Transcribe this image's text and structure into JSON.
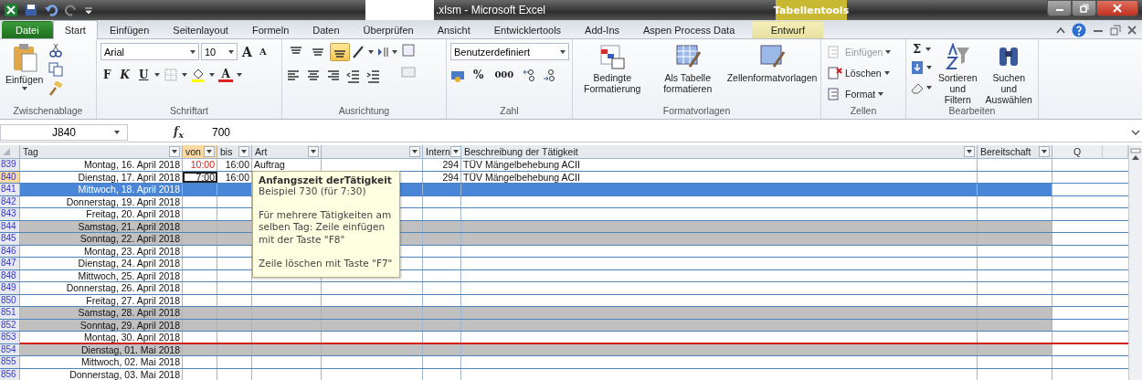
{
  "window": {
    "title": ".xlsm  -  Microsoft Excel",
    "context_tab_group": "Tabellentools"
  },
  "tabs": [
    {
      "label": "Datei",
      "kind": "file",
      "selected": false
    },
    {
      "label": "Start",
      "kind": "normal",
      "selected": true
    },
    {
      "label": "Einfügen",
      "kind": "normal",
      "selected": false
    },
    {
      "label": "Seitenlayout",
      "kind": "normal",
      "selected": false
    },
    {
      "label": "Formeln",
      "kind": "normal",
      "selected": false
    },
    {
      "label": "Daten",
      "kind": "normal",
      "selected": false
    },
    {
      "label": "Überprüfen",
      "kind": "normal",
      "selected": false
    },
    {
      "label": "Ansicht",
      "kind": "normal",
      "selected": false
    },
    {
      "label": "Entwicklertools",
      "kind": "normal",
      "selected": false
    },
    {
      "label": "Add-Ins",
      "kind": "normal",
      "selected": false
    },
    {
      "label": "Aspen Process Data",
      "kind": "normal",
      "selected": false
    },
    {
      "label": "Entwurf",
      "kind": "contextual",
      "selected": false
    }
  ],
  "ribbon": {
    "clipboard": {
      "label": "Zwischenablage",
      "paste": "Einfügen"
    },
    "font": {
      "label": "Schriftart",
      "font_name": "Arial",
      "font_size": "10",
      "grow": "A",
      "shrink": "A",
      "bold": "F",
      "italic": "K",
      "underline": "U",
      "font_color": "A"
    },
    "alignment": {
      "label": "Ausrichtung",
      "vertical": [
        {
          "selected": false
        },
        {
          "selected": false
        },
        {
          "selected": true
        }
      ]
    },
    "number": {
      "label": "Zahl",
      "format": "Benutzerdefiniert",
      "percent": "%",
      "thousands": "000"
    },
    "styles": {
      "label": "Formatvorlagen",
      "buttons": [
        {
          "label": "Bedingte Formatierung",
          "kind": "conditional"
        },
        {
          "label": "Als Tabelle formatieren",
          "kind": "table"
        },
        {
          "label": "Zellenformatvorlagen",
          "kind": "cellstyle"
        }
      ]
    },
    "cells": {
      "label": "Zellen",
      "buttons": [
        {
          "label": "Einfügen",
          "disabled": true
        },
        {
          "label": "Löschen",
          "disabled": false
        },
        {
          "label": "Format",
          "disabled": false
        }
      ]
    },
    "editing": {
      "label": "Bearbeiten",
      "sum": "Σ",
      "sort": "Sortieren und Filtern",
      "find": "Suchen und Auswählen"
    }
  },
  "formula_bar": {
    "name_box": "J840",
    "fx": "f$_{x}$",
    "value": "700"
  },
  "table": {
    "columns": [
      {
        "label": "Tag",
        "active": false
      },
      {
        "label": "von",
        "active": true
      },
      {
        "label": "bis",
        "active": false
      },
      {
        "label": "Art",
        "active": false
      },
      {
        "active": false
      },
      {
        "label": "Intern",
        "active": false
      },
      {
        "label": "Beschreibung der Tätigkeit",
        "active": false
      },
      {
        "label": "Bereitschaft",
        "active": false
      }
    ],
    "sheet_columns": [
      "Q"
    ],
    "rows": [
      {
        "num": "839",
        "tag": "Montag, 16. April 2018",
        "von": "10:00",
        "bis": "16:00",
        "art": "Auftrag",
        "intern": "294",
        "beschreibung": "TÜV Mängelbehebung ACII",
        "kind": "weekday",
        "active": false,
        "von_alert": true,
        "red_bottom": false
      },
      {
        "num": "840",
        "tag": "Dienstag, 17. April 2018",
        "von": "7:00",
        "bis": "16:00",
        "intern": "294",
        "beschreibung": "TÜV Mängelbehebung ACII",
        "kind": "weekday",
        "active": true,
        "von_alert": false,
        "red_bottom": false
      },
      {
        "num": "841",
        "tag": "Mittwoch, 18. April 2018",
        "kind": "selected",
        "active": false,
        "red_bottom": false
      },
      {
        "num": "842",
        "tag": "Donnerstag, 19. April 2018",
        "kind": "weekday",
        "active": false,
        "red_bottom": false
      },
      {
        "num": "843",
        "tag": "Freitag, 20. April 2018",
        "kind": "weekday",
        "active": false,
        "red_bottom": false
      },
      {
        "num": "844",
        "tag": "Samstag, 21. April 2018",
        "kind": "weekend",
        "active": false,
        "red_bottom": false
      },
      {
        "num": "845",
        "tag": "Sonntag, 22. April 2018",
        "kind": "weekend",
        "active": false,
        "red_bottom": false
      },
      {
        "num": "846",
        "tag": "Montag, 23. April 2018",
        "kind": "weekday",
        "active": false,
        "red_bottom": false
      },
      {
        "num": "847",
        "tag": "Dienstag, 24. April 2018",
        "kind": "weekday",
        "active": false,
        "red_bottom": false
      },
      {
        "num": "848",
        "tag": "Mittwoch, 25. April 2018",
        "kind": "weekday",
        "active": false,
        "red_bottom": false
      },
      {
        "num": "849",
        "tag": "Donnerstag, 26. April 2018",
        "kind": "weekday",
        "active": false,
        "red_bottom": false
      },
      {
        "num": "850",
        "tag": "Freitag, 27. April 2018",
        "kind": "weekday",
        "active": false,
        "red_bottom": false
      },
      {
        "num": "851",
        "tag": "Samstag, 28. April 2018",
        "kind": "weekend",
        "active": false,
        "red_bottom": false
      },
      {
        "num": "852",
        "tag": "Sonntag, 29. April 2018",
        "kind": "weekend",
        "active": false,
        "red_bottom": false
      },
      {
        "num": "853",
        "tag": "Montag, 30. April 2018",
        "kind": "weekday",
        "active": false,
        "red_bottom": true
      },
      {
        "num": "854",
        "tag": "Dienstag, 01. Mai 2018",
        "kind": "weekend",
        "active": false,
        "red_bottom": false
      },
      {
        "num": "855",
        "tag": "Mittwoch, 02. Mai 2018",
        "kind": "weekday",
        "active": false,
        "red_bottom": false
      },
      {
        "num": "856",
        "tag": "Donnerstag, 03. Mai 2018",
        "kind": "weekday",
        "active": false,
        "red_bottom": false
      }
    ]
  },
  "tooltip": {
    "title": "Anfangszeit derTätigkeit",
    "paragraphs": [
      "Beispiel 730 (für 7:30)",
      "Für mehrere Tätigkeiten am selben Tag: Zeile einfügen mit der Taste \"F8\"",
      "Zeile löschen mit Taste \"F7\""
    ]
  }
}
